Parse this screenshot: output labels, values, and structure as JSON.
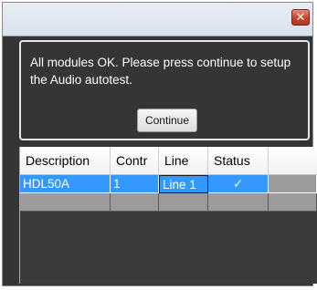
{
  "window": {
    "close_glyph": "✕"
  },
  "dialog": {
    "message": "All modules OK. Please press continue to setup the Audio autotest.",
    "continue_label": "Continue"
  },
  "grid": {
    "columns": [
      "Description",
      "Contr",
      "Line",
      "Status"
    ],
    "rows": [
      {
        "description": "HDL50A",
        "contr": "1",
        "line": "Line 1",
        "status": "✓"
      }
    ]
  },
  "colors": {
    "background": "#353535",
    "selection": "#3399ff",
    "empty_row": "#9b9b9b"
  }
}
